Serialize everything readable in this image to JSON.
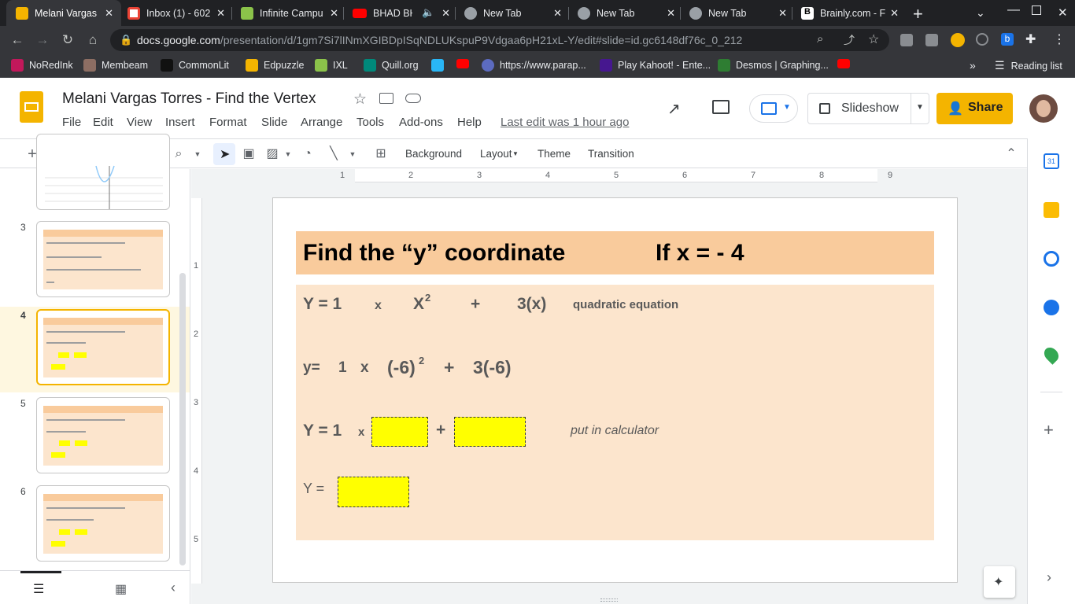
{
  "browser": {
    "tabs": [
      {
        "title": "Melani Vargas",
        "color": "#f4b400",
        "active": true
      },
      {
        "title": "Inbox (1) - 602",
        "color": "#ea4335"
      },
      {
        "title": "Infinite Campu",
        "color": "#8bc34a"
      },
      {
        "title": "BHAD BHA",
        "color": "#ff0000"
      },
      {
        "title": "New Tab",
        "color": "#9aa0a6"
      },
      {
        "title": "New Tab",
        "color": "#9aa0a6"
      },
      {
        "title": "New Tab",
        "color": "#9aa0a6"
      },
      {
        "title": "Brainly.com - F",
        "color": "#ffffff"
      }
    ],
    "url_host": "docs.google.com",
    "url_path": "/presentation/d/1gm7Si7lINmXGIBDpISqNDLUKspuP9Vdgaa6pH21xL-Y/edit#slide=id.gc6148df76c_0_212",
    "bookmarks": [
      {
        "label": "NoRedInk",
        "color": "#c2185b"
      },
      {
        "label": "Membeam",
        "color": "#8d6e63"
      },
      {
        "label": "CommonLit",
        "color": "#212121"
      },
      {
        "label": "Edpuzzle",
        "color": "#f4b400"
      },
      {
        "label": "IXL",
        "color": "#8bc34a"
      },
      {
        "label": "Quill.org",
        "color": "#00897b"
      },
      {
        "label": "",
        "color": "#29b6f6"
      },
      {
        "label": "",
        "color": "#ff0000"
      },
      {
        "label": "https://www.parap...",
        "color": "#5c6bc0"
      },
      {
        "label": "Play Kahoot! - Ente...",
        "color": "#46178f"
      },
      {
        "label": "Desmos | Graphing...",
        "color": "#2e7d32"
      },
      {
        "label": "",
        "color": "#ff0000"
      }
    ],
    "reading_list": "Reading list"
  },
  "doc": {
    "title": "Melani Vargas Torres - Find  the  Vertex",
    "menu": [
      "File",
      "Edit",
      "View",
      "Insert",
      "Format",
      "Slide",
      "Arrange",
      "Tools",
      "Add-ons",
      "Help"
    ],
    "last_edit": "Last edit was 1 hour ago",
    "slideshow": "Slideshow",
    "share": "Share"
  },
  "toolbar": {
    "background": "Background",
    "layout": "Layout",
    "theme": "Theme",
    "transition": "Transition"
  },
  "ruler": [
    "1",
    "2",
    "3",
    "4",
    "5",
    "6",
    "7",
    "8",
    "9"
  ],
  "vruler": [
    "1",
    "2",
    "3",
    "4",
    "5"
  ],
  "filmstrip": {
    "numbers": [
      "3",
      "4",
      "5",
      "6"
    ],
    "selected": "4"
  },
  "slide": {
    "title": "Find the “y” coordinate",
    "condition": "If   x  =   - 4",
    "line1": {
      "y": "Y  =   1",
      "x": "x",
      "x2": "X",
      "sup": "2",
      "plus": "+",
      "term": "3(x)",
      "label": "quadratic  equation"
    },
    "line2": {
      "y": "y=",
      "one": "1",
      "x": "x",
      "sq": "(-6)",
      "sup": "2",
      "plus": "+",
      "term": "3(-6)"
    },
    "line3": {
      "y": "Y  =  1",
      "x": "x",
      "plus": "+",
      "note": "put in calculator"
    },
    "line4": {
      "y": "Y  ="
    }
  },
  "colors": {
    "title_band": "#f9cb9c",
    "body_band": "#fce5cd",
    "answer_box": "#ffff00",
    "accent": "#f4b400"
  }
}
